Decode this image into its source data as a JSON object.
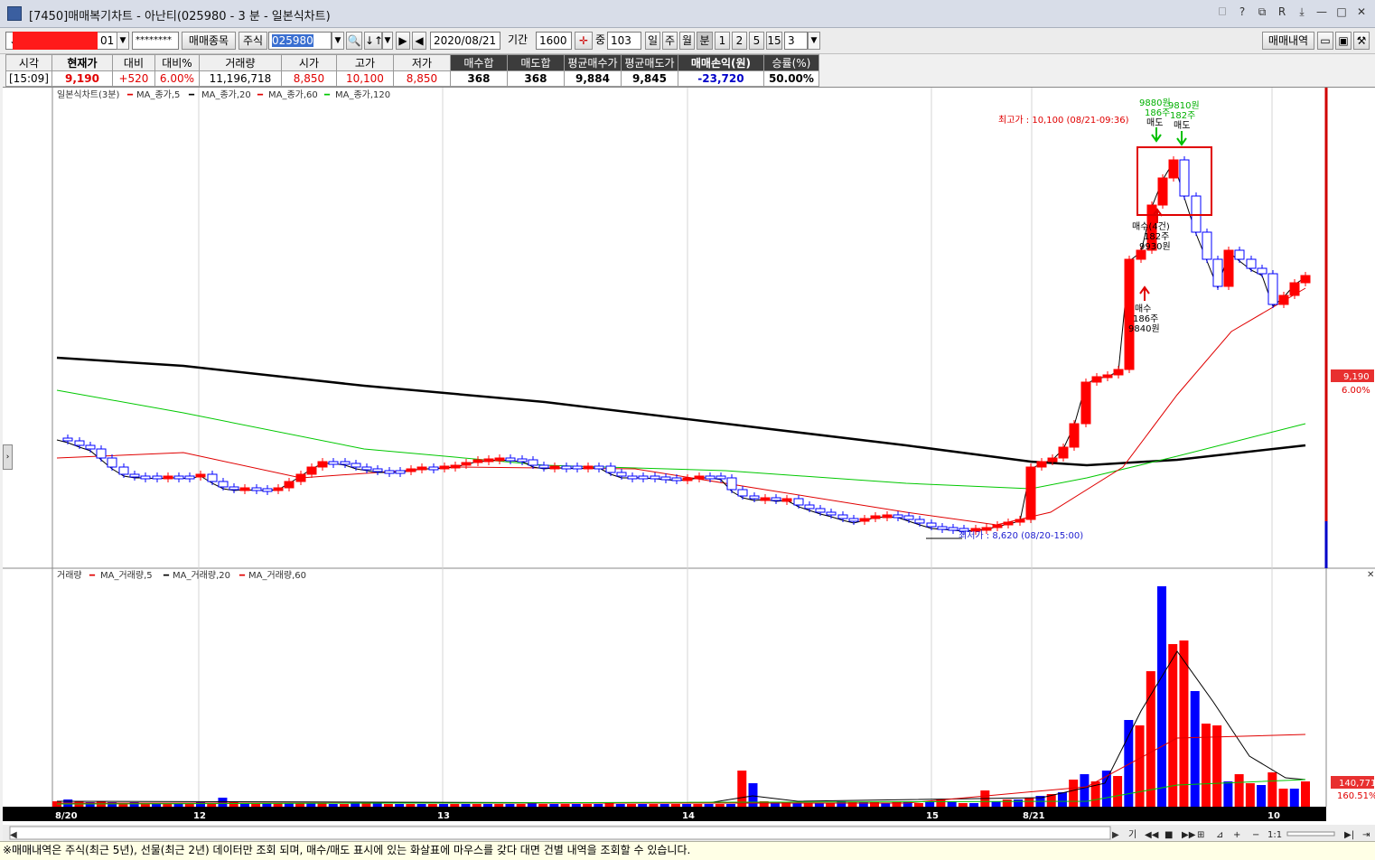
{
  "window": {
    "title": "[7450]매매복기차트 - 아난티(025980 - 3 분 - 일본식차트)",
    "controls": [
      "🗆",
      "?",
      "⧉",
      "R",
      "⤓",
      "—",
      "□",
      "✕"
    ]
  },
  "toolbar": {
    "account_suffix": "01",
    "password": "********",
    "trade_items_label": "매매종목",
    "market_label": "주식",
    "stock_code": "025980",
    "date": "2020/08/21",
    "period_label": "기간",
    "period_value": "1600",
    "count_label": "중",
    "count_value": "103",
    "day_label": "일",
    "week_label": "주",
    "month_label": "월",
    "minute_label": "분",
    "interval_1": "1",
    "interval_2": "2",
    "interval_5": "5",
    "interval_15": "15",
    "interval_current": "3",
    "trade_history_label": "매매내역"
  },
  "info": {
    "headers": [
      "시각",
      "현재가",
      "대비",
      "대비%",
      "거래량",
      "시가",
      "고가",
      "저가",
      "매수합",
      "매도합",
      "평균매수가",
      "평균매도가",
      "매매손익(원)",
      "승률(%)"
    ],
    "values": [
      "[15:09]",
      "9,190",
      "+520",
      "6.00%",
      "11,196,718",
      "8,850",
      "10,100",
      "8,850",
      "368",
      "368",
      "9,884",
      "9,845",
      "-23,720",
      "50.00%"
    ]
  },
  "chart": {
    "price_legend": {
      "title": "일본식차트(3분)",
      "ma5": "MA_종가,5",
      "ma20": "MA_종가,20",
      "ma60": "MA_종가,60",
      "ma120": "MA_종가,120"
    },
    "volume_legend": {
      "title": "거래량",
      "ma5": "MA_거래량,5",
      "ma20": "MA_거래량,20",
      "ma60": "MA_거래량,60"
    },
    "annotations": {
      "high_label": "최고가 : 10,100 (08/21-09:36)",
      "low_label": "최저가 : 8,620 (08/20-15:00)",
      "buy1": [
        "매수",
        "186주",
        "9840원"
      ],
      "buy2": [
        "매수(4건)",
        "182주",
        "9930원"
      ],
      "sell1": [
        "9880원",
        "186주",
        "매도"
      ],
      "sell2": [
        "9810원",
        "182주",
        "매도"
      ]
    },
    "price_box": {
      "price": "9,190",
      "pct": "6.00%"
    },
    "volume_box": {
      "value": "140,771",
      "pct": "160.51%"
    },
    "x_labels": [
      "8/20",
      "12",
      "13",
      "14",
      "15",
      "8/21",
      "10"
    ],
    "colors": {
      "up": "#ff0000",
      "down": "#0000ff",
      "ma5": "#000000",
      "ma20": "#e00000",
      "ma60": "#00c800",
      "ma120": "#000000"
    }
  },
  "bottom_controls": [
    "기",
    "◀◀",
    "■",
    "▶▶",
    "⊞",
    "⊿",
    "+",
    "−",
    "1:1",
    "▶|",
    "⇥"
  ],
  "status": "※매매내역은 주식(최근 5년), 선물(최근 2년) 데이터만 조회 되며, 매수/매도 표시에 있는 화살표에 마우스를 갖다 대면 건별 내역을 조회할 수 있습니다."
}
